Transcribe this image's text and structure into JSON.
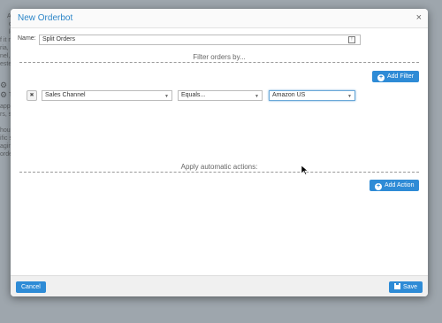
{
  "background": {
    "lines": [
      "A",
      "ce",
      "lo",
      "f it m",
      "ria, s",
      "nel, :",
      "ested",
      "T",
      "appl",
      "rs, s",
      "hous",
      "ific s",
      "agin",
      "order,"
    ]
  },
  "modal": {
    "title": "New Orderbot",
    "close_label": "×",
    "name_label": "Name:",
    "name_value": "Split Orders",
    "filter_section_title": "Filter orders by...",
    "add_filter_label": "Add Filter",
    "filter": {
      "remove_label": "✖",
      "field": "Sales Channel",
      "operator": "Equals...",
      "value": "Amazon US"
    },
    "actions_section_title": "Apply automatic actions:",
    "add_action_label": "Add Action",
    "cancel_label": "Cancel",
    "save_label": "Save"
  },
  "icons": {
    "close": "close-icon",
    "plus": "plus-circle-icon",
    "save": "floppy-disk-icon",
    "remove": "x-icon",
    "caret": "chevron-down-icon",
    "gear": "gear-icon",
    "name_field": "info-icon"
  },
  "colors": {
    "accent": "#2e8bd6",
    "title": "#2d86c8",
    "overlay": "#9ea6ad"
  }
}
